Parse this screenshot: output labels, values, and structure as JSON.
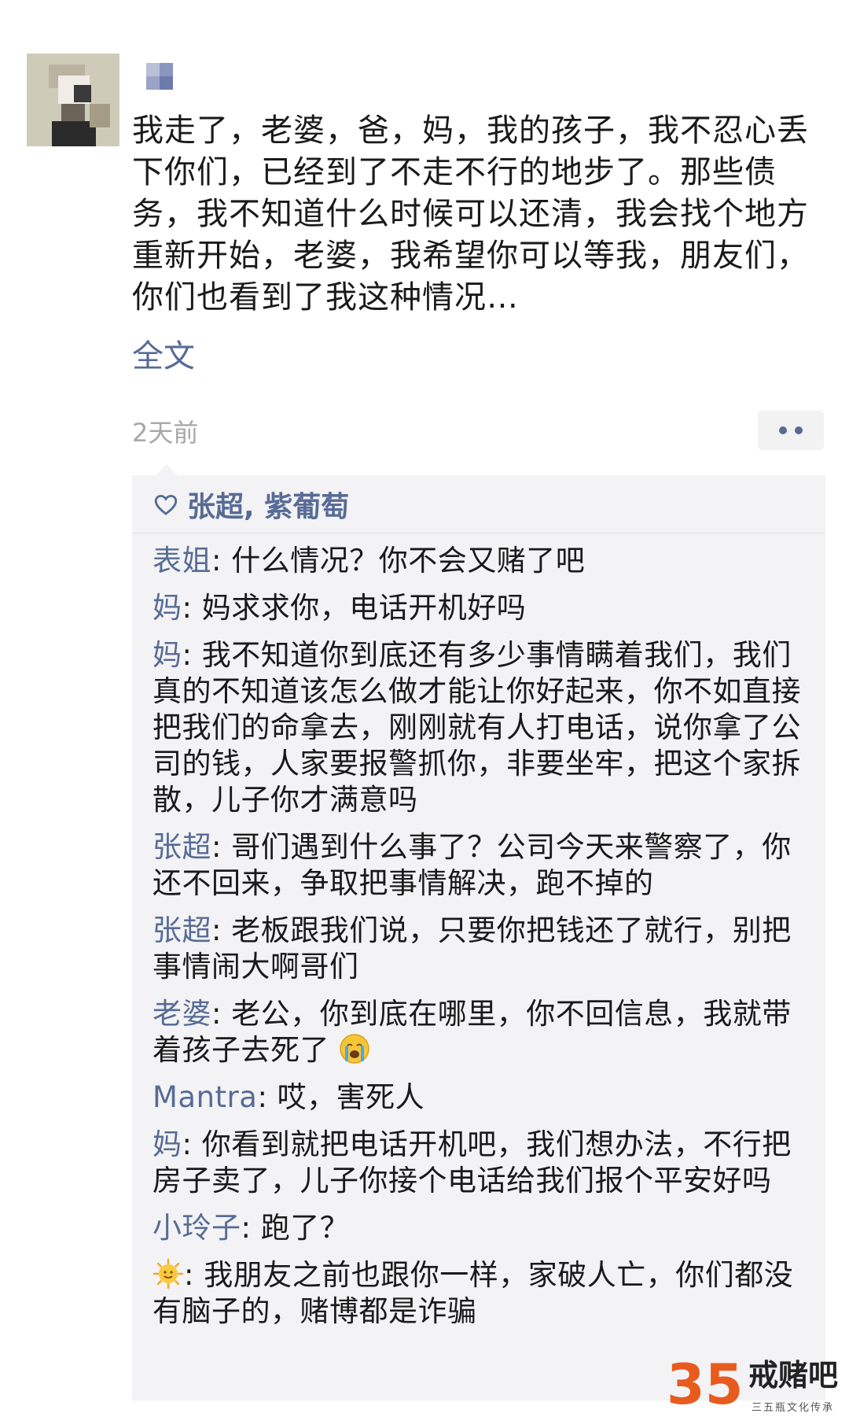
{
  "post": {
    "text": "我走了，老婆，爸，妈，我的孩子，我不忍心丢下你们，已经到了不走不行的地步了。那些债务，我不知道什么时候可以还清，我会找个地方重新开始，老婆，我希望你可以等我，朋友们，你们也看到了我这种情况…",
    "full_text_label": "全文",
    "timestamp": "2天前"
  },
  "likes": {
    "names": "张超, 紫葡萄",
    "icon": "heart-outline-icon"
  },
  "comments": [
    {
      "author": "表姐",
      "text": ": 什么情况？你不会又赌了吧"
    },
    {
      "author": "妈",
      "text": ": 妈求求你，电话开机好吗"
    },
    {
      "author": "妈",
      "text": ": 我不知道你到底还有多少事情瞒着我们，我们真的不知道该怎么做才能让你好起来，你不如直接把我们的命拿去，刚刚就有人打电话，说你拿了公司的钱，人家要报警抓你，非要坐牢，把这个家拆散，儿子你才满意吗"
    },
    {
      "author": "张超",
      "text": ": 哥们遇到什么事了？公司今天来警察了，你还不回来，争取把事情解决，跑不掉的"
    },
    {
      "author": "张超",
      "text": ": 老板跟我们说，只要你把钱还了就行，别把事情闹大啊哥们"
    },
    {
      "author": "老婆",
      "text": ": 老公，你到底在哪里，你不回信息，我就带着孩子去死了",
      "emoji": "crying-face-icon"
    },
    {
      "author": "Mantra",
      "text": ": 哎，害死人"
    },
    {
      "author": "妈",
      "text": ": 你看到就把电话开机吧，我们想办法，不行把房子卖了，儿子你接个电话给我们报个平安好吗"
    },
    {
      "author": "小玲子",
      "text": ": 跑了？"
    },
    {
      "author_icon": "sun-face-icon",
      "text": ": 我朋友之前也跟你一样，家破人亡，你们都没有脑子的，赌博都是诈骗"
    }
  ],
  "watermark": {
    "number": "35",
    "title": "戒赌吧",
    "subtitle": "三五瓶文化传承"
  },
  "colors": {
    "link": "#576b95",
    "comment_bg": "#f3f3f5",
    "timestamp": "#a8a8a8",
    "watermark_accent": "#e85b1e"
  }
}
